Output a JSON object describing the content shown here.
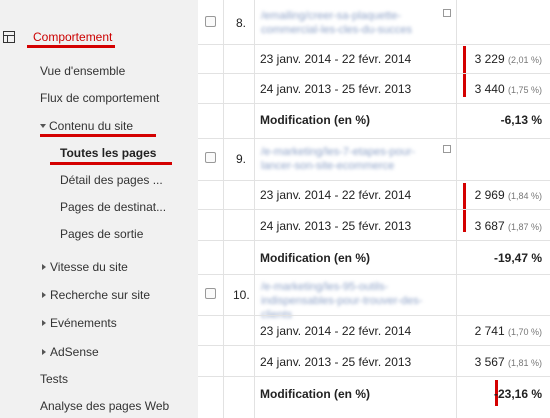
{
  "sidebar": {
    "top": "Comportement",
    "items": {
      "overview": "Vue d'ensemble",
      "flow": "Flux de comportement",
      "content": "Contenu du site",
      "all_pages": "Toutes les pages",
      "detail": "Détail des pages ...",
      "landing": "Pages de destinat...",
      "exit": "Pages de sortie",
      "speed": "Vitesse du site",
      "search": "Recherche sur site",
      "events": "Evénements",
      "adsense": "AdSense",
      "tests": "Tests",
      "analysis": "Analyse des pages Web"
    }
  },
  "rows": [
    {
      "num": "8.",
      "url": "/emailing/creer-sa-plaquette-commercial-les-cles-du-succes",
      "d1": "23 janv. 2014 - 22 févr. 2014",
      "v1": "3 229",
      "p1": "(2,01 %)",
      "d2": "24 janv. 2013 - 25 févr. 2013",
      "v2": "3 440",
      "p2": "(1,75 %)",
      "mod_label": "Modification (en %)",
      "mod": "-6,13 %"
    },
    {
      "num": "9.",
      "url": "/e-marketing/les-7-etapes-pour-lancer-son-site-ecommerce",
      "d1": "23 janv. 2014 - 22 févr. 2014",
      "v1": "2 969",
      "p1": "(1,84 %)",
      "d2": "24 janv. 2013 - 25 févr. 2013",
      "v2": "3 687",
      "p2": "(1,87 %)",
      "mod_label": "Modification (en %)",
      "mod": "-19,47 %"
    },
    {
      "num": "10.",
      "url": "/e-marketing/les-95-outils-indispensables-pour-trouver-des-clients",
      "d1": "23 janv. 2014 - 22 févr. 2014",
      "v1": "2 741",
      "p1": "(1,70 %)",
      "d2": "24 janv. 2013 - 25 févr. 2013",
      "v2": "3 567",
      "p2": "(1,81 %)",
      "mod_label": "Modification (en %)",
      "mod": "-23,16 %"
    }
  ],
  "colors": {
    "highlight": "#d40000",
    "sidebar_bg": "#f1f1f1"
  }
}
